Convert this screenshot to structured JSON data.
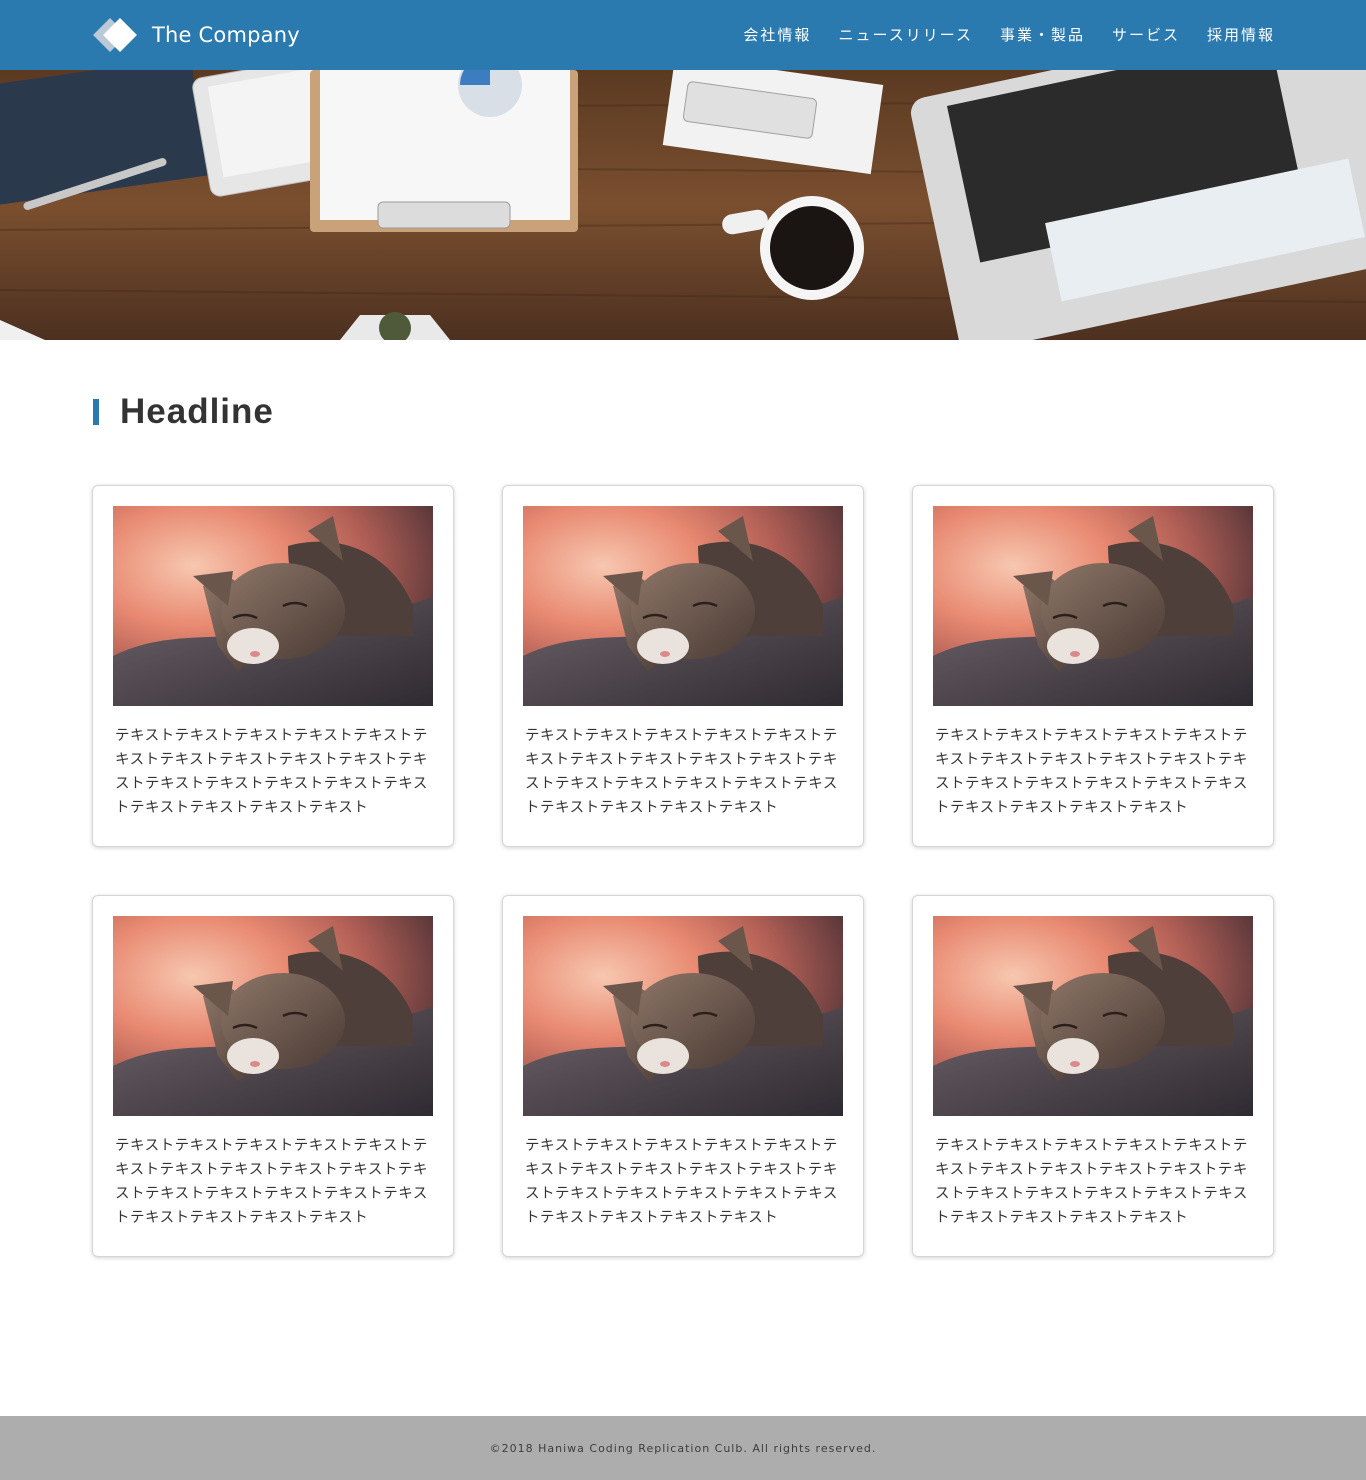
{
  "header": {
    "brand": "The Company",
    "nav": [
      "会社情報",
      "ニュースリリース",
      "事業・製品",
      "サービス",
      "採用情報"
    ]
  },
  "colors": {
    "brand": "#2a7ab0",
    "footer": "#adadad"
  },
  "hero": {
    "image": "desk-workspace-photo"
  },
  "main": {
    "headline": "Headline",
    "cards": [
      {
        "image": "sleeping-cat-photo",
        "text": "テキストテキストテキストテキストテキストテキストテキストテキストテキストテキストテキストテキストテキストテキストテキストテキストテキストテキストテキストテキスト"
      },
      {
        "image": "sleeping-cat-photo",
        "text": "テキストテキストテキストテキストテキストテキストテキストテキストテキストテキストテキストテキストテキストテキストテキストテキストテキストテキストテキストテキスト"
      },
      {
        "image": "sleeping-cat-photo",
        "text": "テキストテキストテキストテキストテキストテキストテキストテキストテキストテキストテキストテキストテキストテキストテキストテキストテキストテキストテキストテキスト"
      },
      {
        "image": "sleeping-cat-photo",
        "text": "テキストテキストテキストテキストテキストテキストテキストテキストテキストテキストテキストテキストテキストテキストテキストテキストテキストテキストテキストテキスト"
      },
      {
        "image": "sleeping-cat-photo",
        "text": "テキストテキストテキストテキストテキストテキストテキストテキストテキストテキストテキストテキストテキストテキストテキストテキストテキストテキストテキストテキスト"
      },
      {
        "image": "sleeping-cat-photo",
        "text": "テキストテキストテキストテキストテキストテキストテキストテキストテキストテキストテキストテキストテキストテキストテキストテキストテキストテキストテキストテキスト"
      }
    ]
  },
  "footer": {
    "copyright": "©2018 Haniwa Coding Replication Culb. All rights reserved."
  }
}
